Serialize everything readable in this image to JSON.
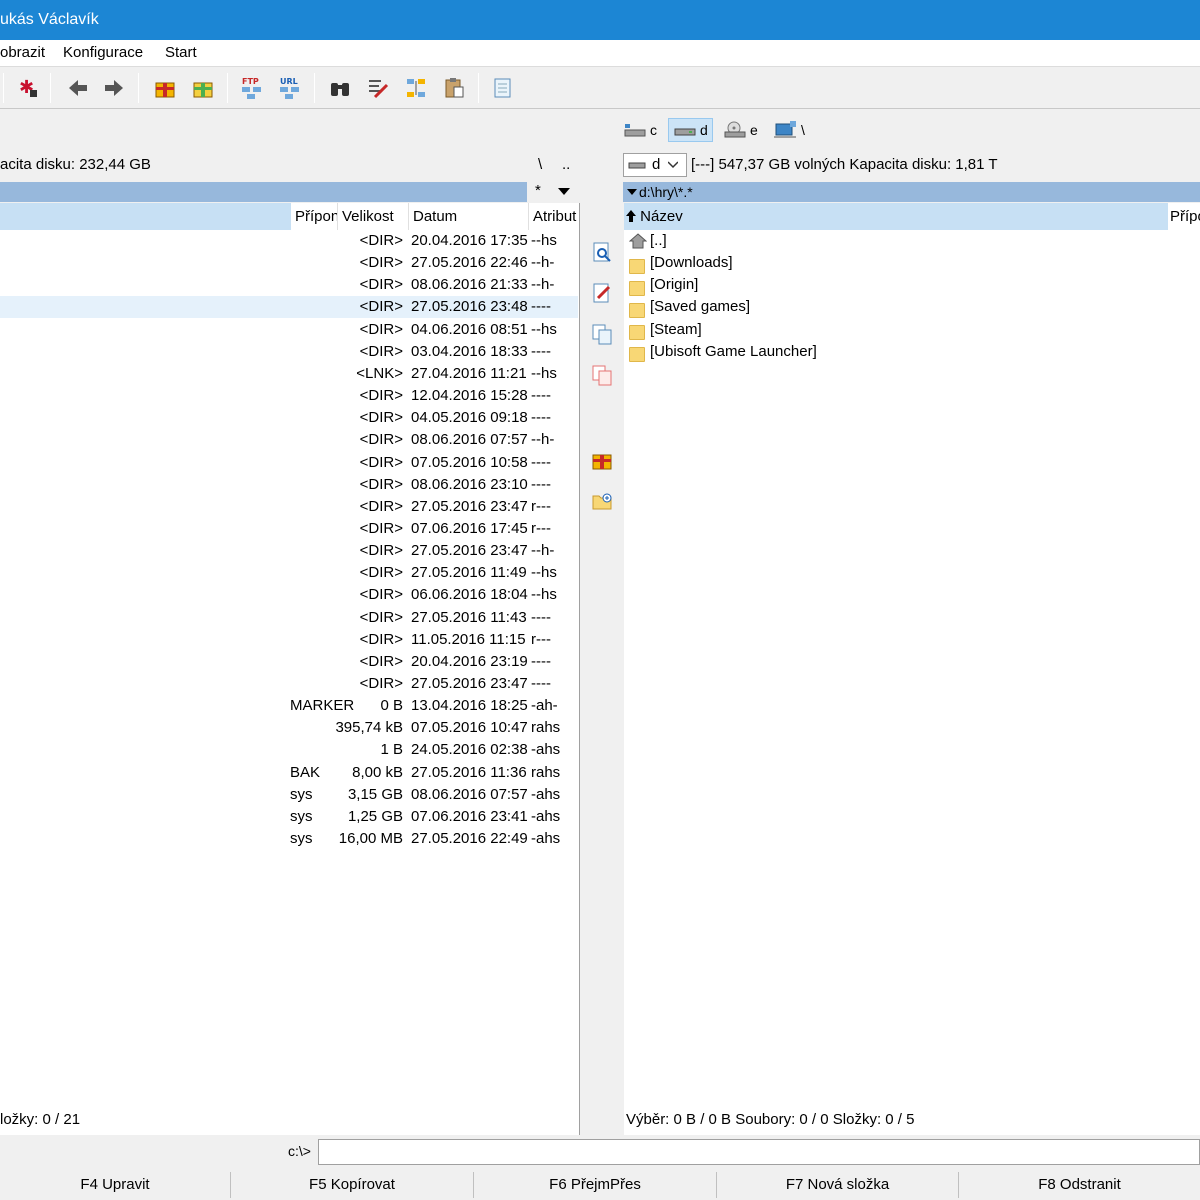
{
  "window": {
    "title": "ukás Václavík"
  },
  "menu": [
    "obrazit",
    "Konfigurace",
    "Start"
  ],
  "drives": [
    {
      "label": "c",
      "icon": "hdd-network-icon"
    },
    {
      "label": "d",
      "icon": "hdd-icon",
      "active": true
    },
    {
      "label": "e",
      "icon": "dvd-drive-icon"
    },
    {
      "label": "\\",
      "icon": "network-icon"
    }
  ],
  "left": {
    "info": "acita disku: 232,44 GB",
    "root_btn": "\\",
    "up_btn": "..",
    "filter_star": "*",
    "headers": {
      "ext": "Přípon",
      "size": "Velikost",
      "date": "Datum",
      "attr": "Atribut"
    },
    "rows": [
      {
        "ext": "",
        "size": "<DIR>",
        "date": "20.04.2016 17:35",
        "attr": "--hs"
      },
      {
        "ext": "",
        "size": "<DIR>",
        "date": "27.05.2016 22:46",
        "attr": "--h-"
      },
      {
        "ext": "",
        "size": "<DIR>",
        "date": "08.06.2016 21:33",
        "attr": "--h-"
      },
      {
        "ext": "",
        "size": "<DIR>",
        "date": "27.05.2016 23:48",
        "attr": "----"
      },
      {
        "ext": "",
        "size": "<DIR>",
        "date": "04.06.2016 08:51",
        "attr": "--hs"
      },
      {
        "ext": "",
        "size": "<DIR>",
        "date": "03.04.2016 18:33",
        "attr": "----"
      },
      {
        "ext": "",
        "size": "<LNK>",
        "date": "27.04.2016 11:21",
        "attr": "--hs"
      },
      {
        "ext": "",
        "size": "<DIR>",
        "date": "12.04.2016 15:28",
        "attr": "----"
      },
      {
        "ext": "",
        "size": "<DIR>",
        "date": "04.05.2016 09:18",
        "attr": "----"
      },
      {
        "ext": "",
        "size": "<DIR>",
        "date": "08.06.2016 07:57",
        "attr": "--h-"
      },
      {
        "ext": "",
        "size": "<DIR>",
        "date": "07.05.2016 10:58",
        "attr": "----"
      },
      {
        "ext": "",
        "size": "<DIR>",
        "date": "08.06.2016 23:10",
        "attr": "----"
      },
      {
        "ext": "",
        "size": "<DIR>",
        "date": "27.05.2016 23:47",
        "attr": "r---"
      },
      {
        "ext": "",
        "size": "<DIR>",
        "date": "07.06.2016 17:45",
        "attr": "r---"
      },
      {
        "ext": "",
        "size": "<DIR>",
        "date": "27.05.2016 23:47",
        "attr": "--h-"
      },
      {
        "ext": "",
        "size": "<DIR>",
        "date": "27.05.2016 11:49",
        "attr": "--hs"
      },
      {
        "ext": "",
        "size": "<DIR>",
        "date": "06.06.2016 18:04",
        "attr": "--hs"
      },
      {
        "ext": "",
        "size": "<DIR>",
        "date": "27.05.2016 11:43",
        "attr": "----"
      },
      {
        "ext": "",
        "size": "<DIR>",
        "date": "11.05.2016 11:15",
        "attr": "r---"
      },
      {
        "ext": "",
        "size": "<DIR>",
        "date": "20.04.2016 23:19",
        "attr": "----"
      },
      {
        "ext": "",
        "size": "<DIR>",
        "date": "27.05.2016 23:47",
        "attr": "----"
      },
      {
        "ext": "MARKER",
        "size": "0 B",
        "date": "13.04.2016 18:25",
        "attr": "-ah-"
      },
      {
        "ext": "",
        "size": "395,74 kB",
        "date": "07.05.2016 10:47",
        "attr": "rahs"
      },
      {
        "ext": "",
        "size": "1 B",
        "date": "24.05.2016 02:38",
        "attr": "-ahs"
      },
      {
        "ext": "BAK",
        "size": "8,00 kB",
        "date": "27.05.2016 11:36",
        "attr": "rahs"
      },
      {
        "ext": "sys",
        "size": "3,15 GB",
        "date": "08.06.2016 07:57",
        "attr": "-ahs"
      },
      {
        "ext": "sys",
        "size": "1,25 GB",
        "date": "07.06.2016 23:41",
        "attr": "-ahs"
      },
      {
        "ext": "sys",
        "size": "16,00 MB",
        "date": "27.05.2016 22:49",
        "attr": "-ahs"
      }
    ],
    "status": "ložky: 0 / 21"
  },
  "right": {
    "drive_value": "d",
    "info": "[---]  547,37 GB volných  Kapacita disku: 1,81 T",
    "path": "d:\\hry\\*.*",
    "headers": {
      "name": "Název",
      "ext": "Přípo"
    },
    "rows": [
      "[..]",
      "[Downloads]",
      "[Origin]",
      "[Saved games]",
      "[Steam]",
      "[Ubisoft Game Launcher]"
    ],
    "status": "Výběr: 0 B / 0 B  Soubory: 0 / 0  Složky: 0 / 5"
  },
  "cmdline": {
    "prompt": "c:\\>",
    "value": ""
  },
  "fkeys": [
    "F4 Upravit",
    "F5 Kopírovat",
    "F6 PřejmPřes",
    "F7 Nová složka",
    "F8 Odstranit"
  ]
}
